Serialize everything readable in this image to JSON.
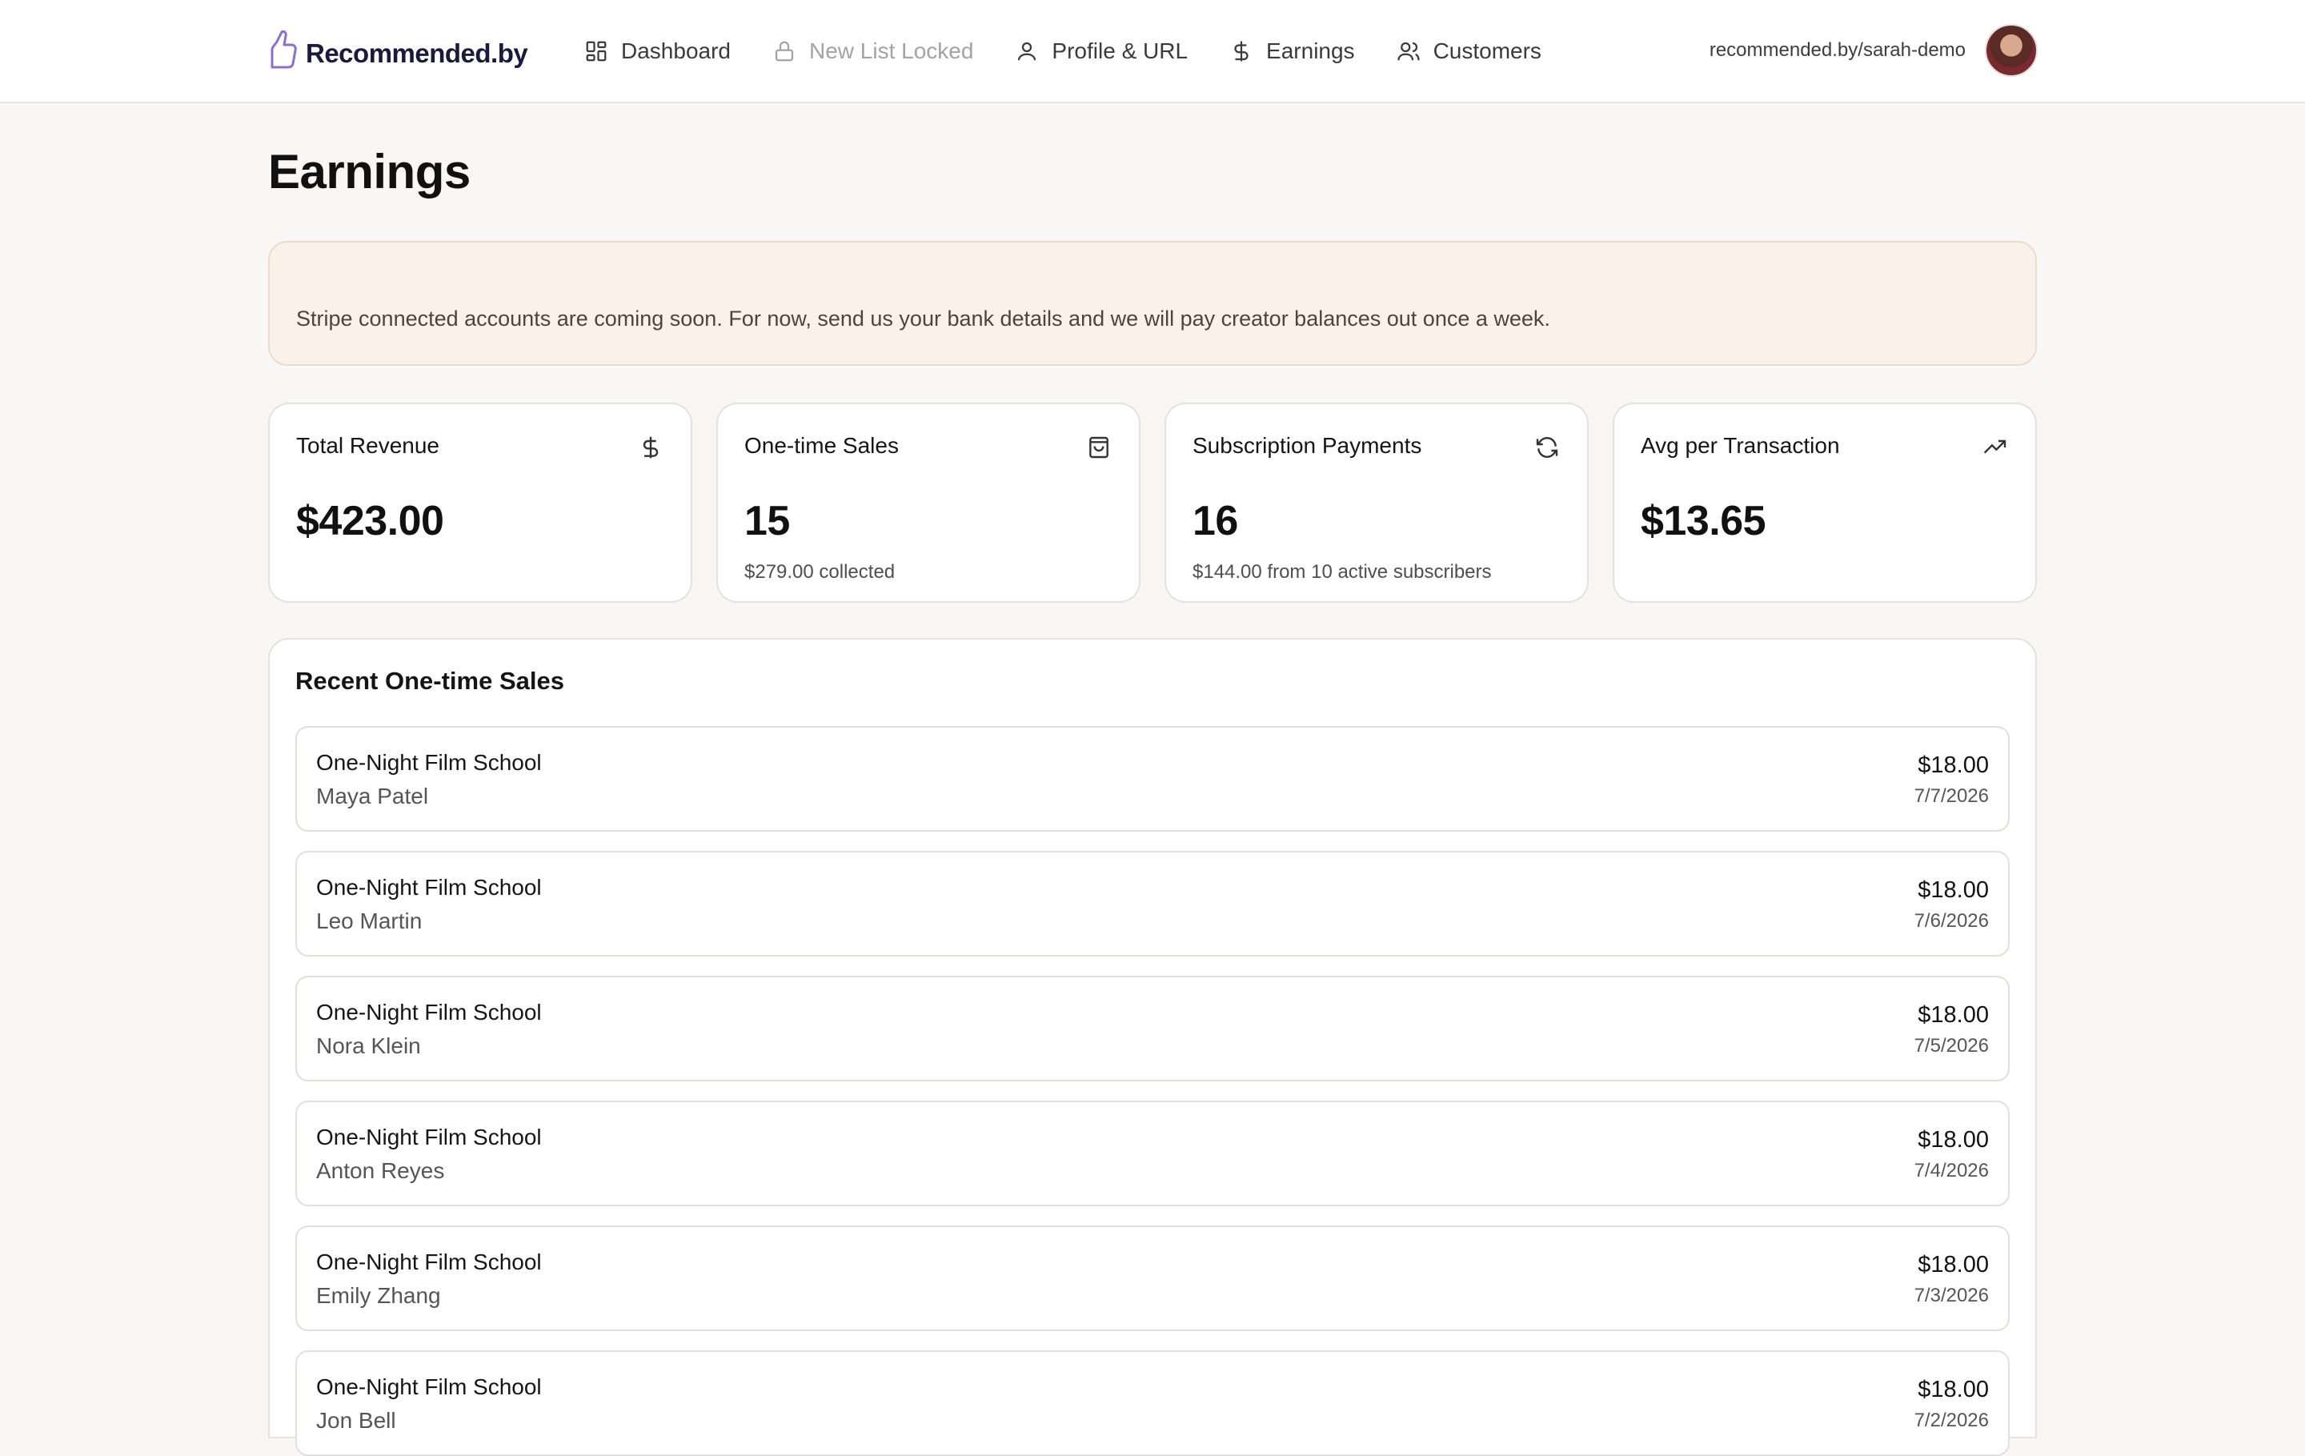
{
  "brand": {
    "name": "Recommended.by",
    "accent": "#7c5cc4"
  },
  "nav": {
    "items": [
      {
        "label": "Dashboard",
        "icon": "dashboard-icon"
      },
      {
        "label": "New List Locked",
        "icon": "lock-icon"
      },
      {
        "label": "Profile & URL",
        "icon": "user-icon"
      },
      {
        "label": "Earnings",
        "icon": "dollar-icon"
      },
      {
        "label": "Customers",
        "icon": "users-icon"
      }
    ]
  },
  "user": {
    "url": "recommended.by/sarah-demo"
  },
  "page": {
    "title": "Earnings"
  },
  "banner": {
    "text": "Stripe connected accounts are coming soon. For now, send us your bank details and we will pay creator balances out once a week."
  },
  "stats": [
    {
      "label": "Total Revenue",
      "value": "$423.00",
      "sub": "",
      "icon": "dollar-icon"
    },
    {
      "label": "One-time Sales",
      "value": "15",
      "sub": "$279.00 collected",
      "icon": "shopping-bag-icon"
    },
    {
      "label": "Subscription Payments",
      "value": "16",
      "sub": "$144.00 from 10 active subscribers",
      "icon": "refresh-icon"
    },
    {
      "label": "Avg per Transaction",
      "value": "$13.65",
      "sub": "",
      "icon": "trending-up-icon"
    }
  ],
  "sales": {
    "title": "Recent One-time Sales",
    "rows": [
      {
        "product": "One-Night Film School",
        "customer": "Maya Patel",
        "amount": "$18.00",
        "date": "7/7/2026"
      },
      {
        "product": "One-Night Film School",
        "customer": "Leo Martin",
        "amount": "$18.00",
        "date": "7/6/2026"
      },
      {
        "product": "One-Night Film School",
        "customer": "Nora Klein",
        "amount": "$18.00",
        "date": "7/5/2026"
      },
      {
        "product": "One-Night Film School",
        "customer": "Anton Reyes",
        "amount": "$18.00",
        "date": "7/4/2026"
      },
      {
        "product": "One-Night Film School",
        "customer": "Emily Zhang",
        "amount": "$18.00",
        "date": "7/3/2026"
      },
      {
        "product": "One-Night Film School",
        "customer": "Jon Bell",
        "amount": "$18.00",
        "date": "7/2/2026"
      }
    ]
  }
}
